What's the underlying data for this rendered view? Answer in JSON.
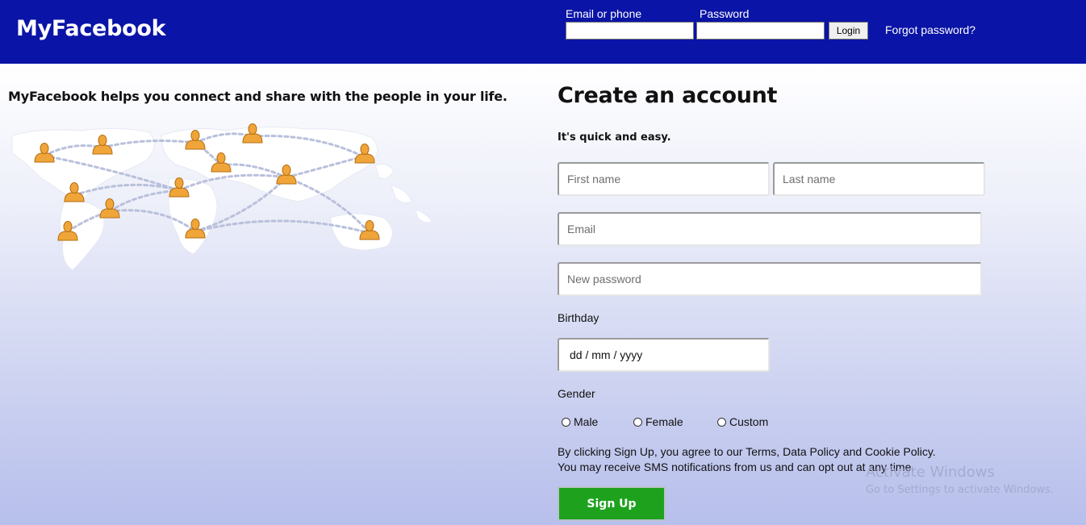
{
  "header": {
    "logo": "MyFacebook",
    "email_label": "Email or phone",
    "password_label": "Password",
    "login_label": "Login",
    "forgot_label": "Forgot password?",
    "color": "#0a14a6"
  },
  "left": {
    "tagline": "MyFacebook helps you connect and share with the people in your life."
  },
  "signup": {
    "title": "Create an account",
    "subtitle": "It's quick and easy.",
    "first_name_placeholder": "First name",
    "last_name_placeholder": "Last name",
    "email_placeholder": "Email",
    "password_placeholder": "New password",
    "birthday_label": "Birthday",
    "birthday_value": "dd / mm / yyyy",
    "gender_label": "Gender",
    "gender_options": [
      "Male",
      "Female",
      "Custom"
    ],
    "terms_line1": "By clicking Sign Up, you agree to our Terms, Data Policy and Cookie Policy.",
    "terms_line2": "You may receive SMS notifications from us and can opt out at any time.",
    "signup_label": "Sign Up",
    "button_color": "#1ea21e"
  },
  "watermark": {
    "line1": "Activate Windows",
    "line2": "Go to Settings to activate Windows."
  }
}
